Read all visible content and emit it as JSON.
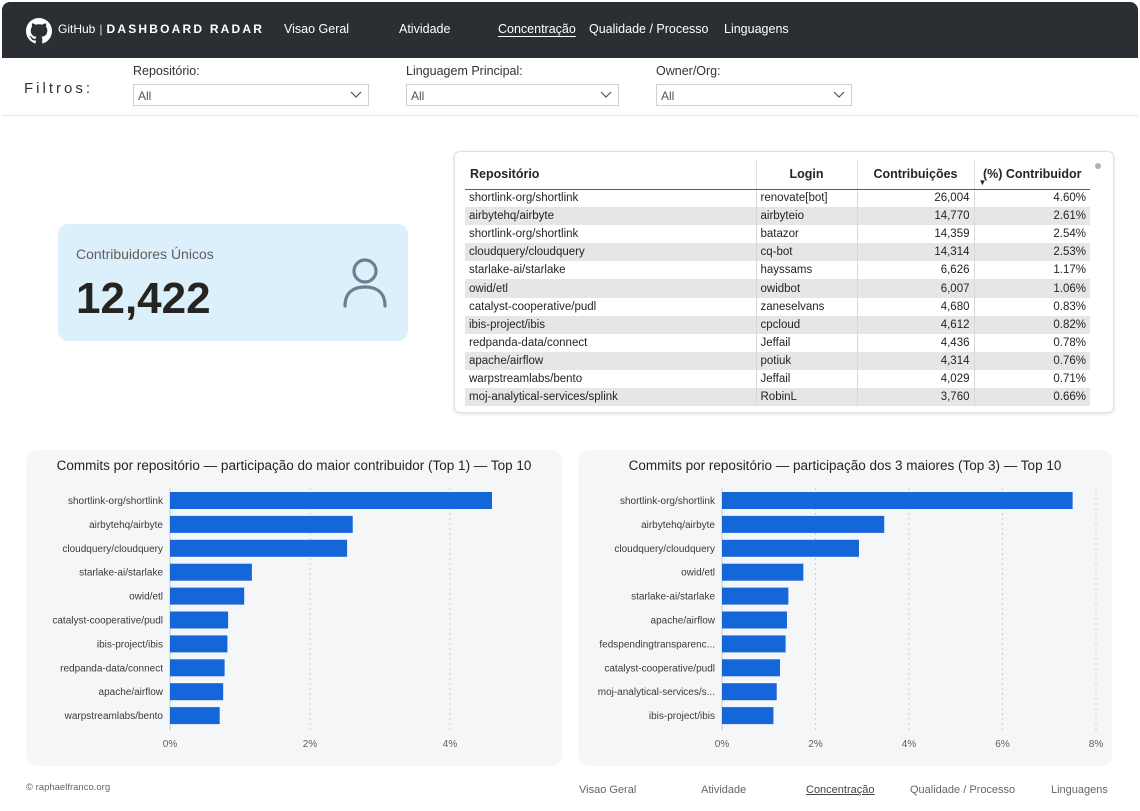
{
  "header": {
    "brand_name": "GitHub",
    "brand_sep": "|",
    "brand_title": "DASHBOARD RADAR",
    "nav": [
      "Visao Geral",
      "Atividade",
      "Concentração",
      "Qualidade / Processo",
      "Linguagens"
    ],
    "active_nav": "Concentração"
  },
  "filters": {
    "label": "Filtros:",
    "items": [
      {
        "label": "Repositório:",
        "value": "All"
      },
      {
        "label": "Linguagem Principal:",
        "value": "All"
      },
      {
        "label": "Owner/Org:",
        "value": "All"
      }
    ]
  },
  "kpi": {
    "title": "Contribuidores Únicos",
    "value": "12,422",
    "icon": "user-icon"
  },
  "table": {
    "columns": [
      "Repositório",
      "Login",
      "Contribuições",
      "(%) Contribuidor"
    ],
    "sort_column": "(%) Contribuidor",
    "rows": [
      [
        "shortlink-org/shortlink",
        "renovate[bot]",
        "26,004",
        "4.60%"
      ],
      [
        "airbytehq/airbyte",
        "airbyteio",
        "14,770",
        "2.61%"
      ],
      [
        "shortlink-org/shortlink",
        "batazor",
        "14,359",
        "2.54%"
      ],
      [
        "cloudquery/cloudquery",
        "cq-bot",
        "14,314",
        "2.53%"
      ],
      [
        "starlake-ai/starlake",
        "hayssams",
        "6,626",
        "1.17%"
      ],
      [
        "owid/etl",
        "owidbot",
        "6,007",
        "1.06%"
      ],
      [
        "catalyst-cooperative/pudl",
        "zaneselvans",
        "4,680",
        "0.83%"
      ],
      [
        "ibis-project/ibis",
        "cpcloud",
        "4,612",
        "0.82%"
      ],
      [
        "redpanda-data/connect",
        "Jeffail",
        "4,436",
        "0.78%"
      ],
      [
        "apache/airflow",
        "potiuk",
        "4,314",
        "0.76%"
      ],
      [
        "warpstreamlabs/bento",
        "Jeffail",
        "4,029",
        "0.71%"
      ],
      [
        "moj-analytical-services/splink",
        "RobinL",
        "3,760",
        "0.66%"
      ]
    ]
  },
  "chart_data": [
    {
      "type": "bar",
      "orientation": "horizontal",
      "title": "Commits por repositório — participação do maior contribuidor (Top 1) — Top 10",
      "categories": [
        "shortlink-org/shortlink",
        "airbytehq/airbyte",
        "cloudquery/cloudquery",
        "starlake-ai/starlake",
        "owid/etl",
        "catalyst-cooperative/pudl",
        "ibis-project/ibis",
        "redpanda-data/connect",
        "apache/airflow",
        "warpstreamlabs/bento"
      ],
      "values": [
        4.6,
        2.61,
        2.53,
        1.17,
        1.06,
        0.83,
        0.82,
        0.78,
        0.76,
        0.71
      ],
      "xlim": [
        0,
        5
      ],
      "xticks": [
        0,
        2,
        4
      ],
      "xtick_labels": [
        "0%",
        "2%",
        "4%"
      ],
      "grid": true,
      "color": "#1466d9"
    },
    {
      "type": "bar",
      "orientation": "horizontal",
      "title": "Commits por repositório — participação dos 3 maiores (Top 3) — Top 10",
      "categories": [
        "shortlink-org/shortlink",
        "airbytehq/airbyte",
        "cloudquery/cloudquery",
        "owid/etl",
        "starlake-ai/starlake",
        "apache/airflow",
        "fedspendingtransparenc...",
        "catalyst-cooperative/pudl",
        "moj-analytical-services/s...",
        "ibis-project/ibis"
      ],
      "values": [
        7.5,
        3.47,
        2.93,
        1.74,
        1.42,
        1.39,
        1.36,
        1.24,
        1.17,
        1.1
      ],
      "xlim": [
        0,
        8
      ],
      "xticks": [
        0,
        2,
        4,
        6,
        8
      ],
      "xtick_labels": [
        "0%",
        "2%",
        "4%",
        "6%",
        "8%"
      ],
      "grid": true,
      "color": "#1466d9"
    }
  ],
  "footer": {
    "copyright": "© raphaelfranco.org",
    "nav": [
      "Visao Geral",
      "Atividade",
      "Concentração",
      "Qualidade / Processo",
      "Linguagens"
    ],
    "active_nav": "Concentração"
  },
  "colors": {
    "header_bg": "#2b2f33",
    "kpi_bg": "#dcf0fb",
    "bar": "#1466d9",
    "chart_bg": "#f5f6f8"
  }
}
